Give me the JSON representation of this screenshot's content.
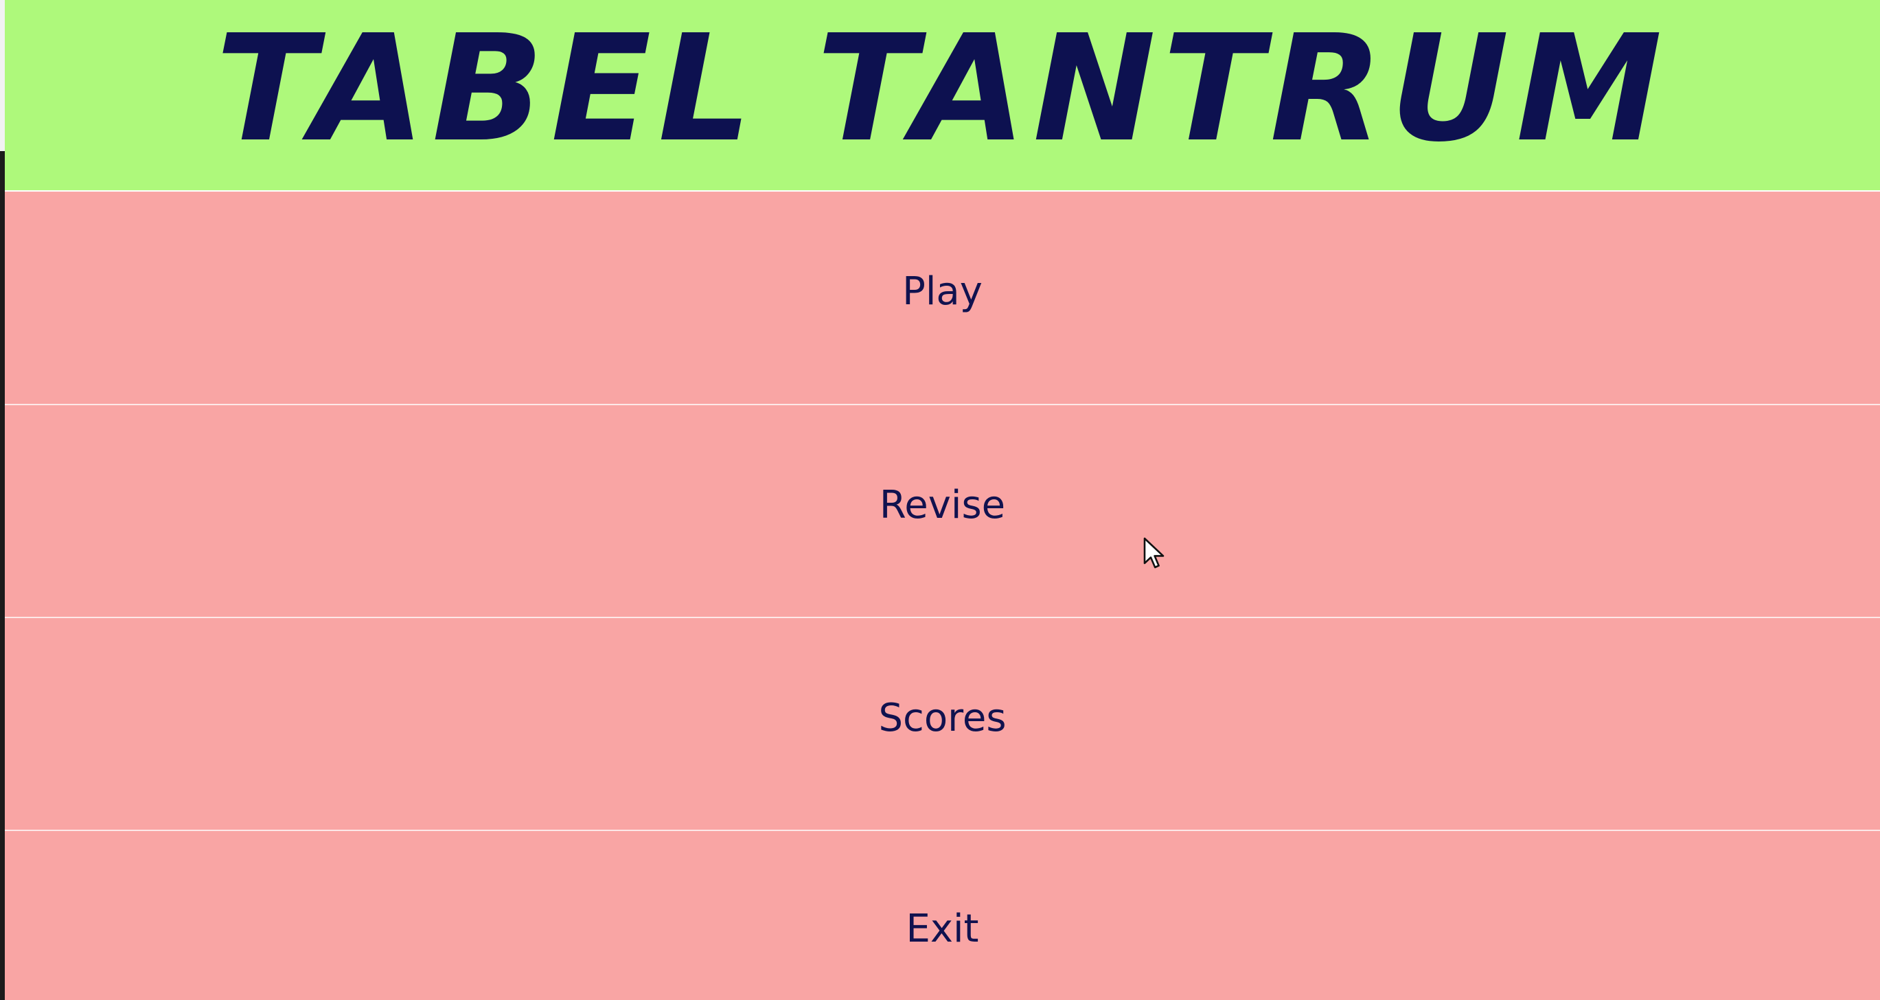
{
  "app": {
    "title": "TABEL TANTRUM",
    "colors": {
      "header_bg": "#aef97b",
      "menu_bg": "#f9a5a4",
      "text": "#11124f",
      "title_text": "#0d1150"
    }
  },
  "menu": {
    "items": [
      {
        "label": "Play"
      },
      {
        "label": "Revise"
      },
      {
        "label": "Scores"
      },
      {
        "label": "Exit"
      }
    ]
  },
  "cursor": {
    "icon": "mouse-pointer-icon"
  }
}
